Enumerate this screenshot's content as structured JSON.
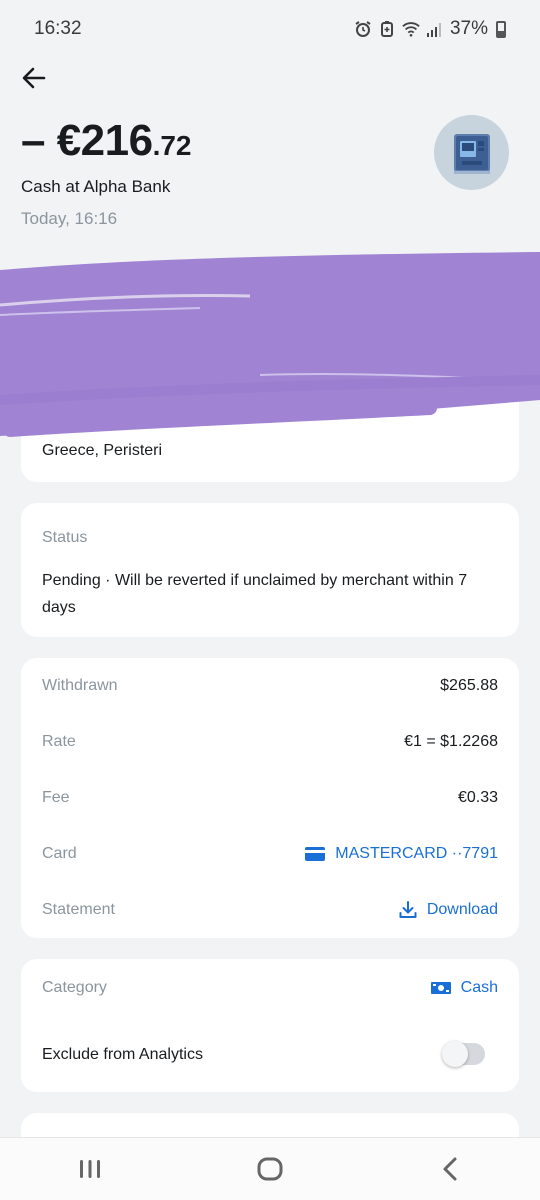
{
  "status_bar": {
    "time": "16:32",
    "battery": "37%",
    "icons": [
      "alarm-icon",
      "battery-saver-icon",
      "wifi-icon",
      "signal-icon",
      "battery-icon"
    ]
  },
  "header": {
    "back_icon": "arrow-left-icon",
    "amount_main": "– €216",
    "amount_cents": ".72",
    "merchant": "Cash at Alpha Bank",
    "date": "Today, 16:16",
    "avatar_icon": "atm-icon"
  },
  "location": {
    "text": "Greece, Peristeri"
  },
  "status": {
    "label": "Status",
    "text": "Pending · Will be reverted if unclaimed by merchant within 7 days"
  },
  "details": {
    "withdrawn_label": "Withdrawn",
    "withdrawn_value": "$265.88",
    "rate_label": "Rate",
    "rate_value": "€1 = $1.2268",
    "fee_label": "Fee",
    "fee_value": "€0.33",
    "card_label": "Card",
    "card_value": "MASTERCARD ··7791",
    "statement_label": "Statement",
    "statement_value": "Download"
  },
  "category": {
    "label": "Category",
    "value": "Cash",
    "exclude_label": "Exclude from Analytics",
    "exclude_on": false
  },
  "colors": {
    "accent": "#1a6fd6",
    "background": "#f2f3f5",
    "redaction": "#a083d3"
  },
  "nav_bar": {
    "icons": [
      "recent-apps-icon",
      "home-icon",
      "back-icon"
    ]
  }
}
